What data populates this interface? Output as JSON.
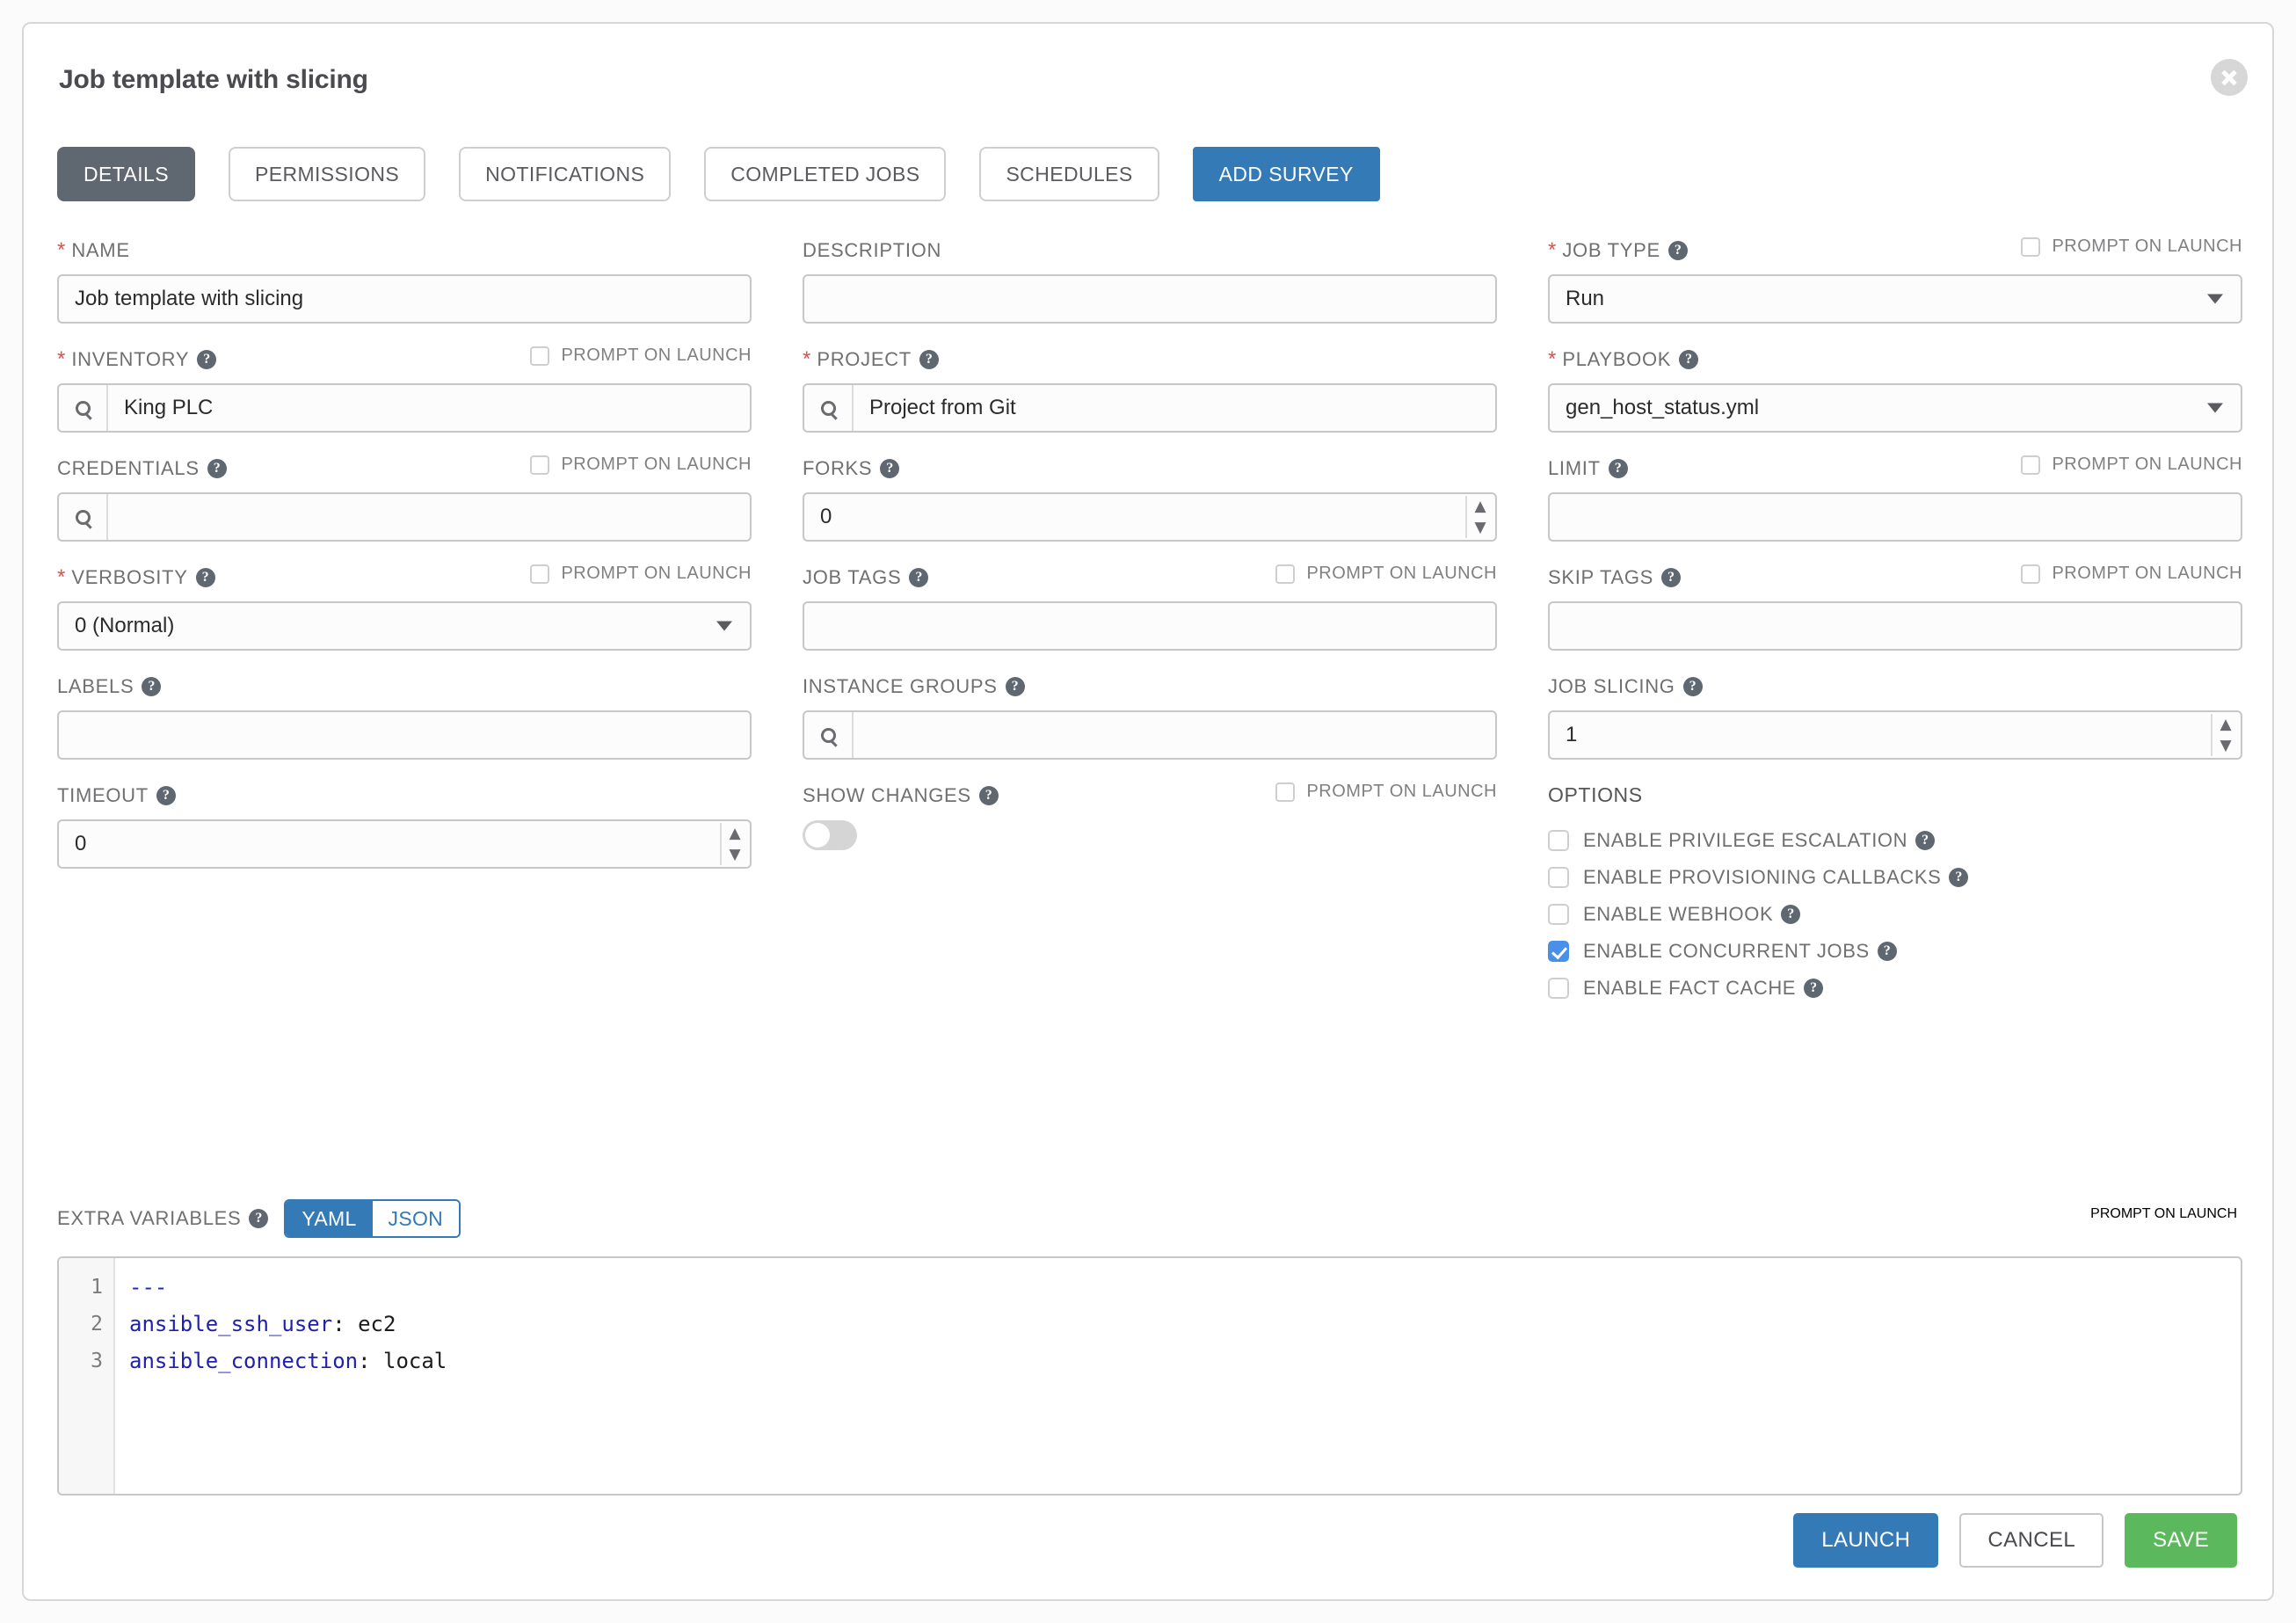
{
  "window": {
    "title": "Job template with slicing",
    "close_icon": "close-icon"
  },
  "tabs": [
    {
      "label": "DETAILS",
      "state": "active"
    },
    {
      "label": "PERMISSIONS",
      "state": "inactive"
    },
    {
      "label": "NOTIFICATIONS",
      "state": "inactive"
    },
    {
      "label": "COMPLETED JOBS",
      "state": "inactive"
    },
    {
      "label": "SCHEDULES",
      "state": "inactive"
    },
    {
      "label": "ADD SURVEY",
      "state": "primary"
    }
  ],
  "prompt_on_launch_label": "PROMPT ON LAUNCH",
  "fields": {
    "name": {
      "label": "NAME",
      "value": "Job template with slicing"
    },
    "description": {
      "label": "DESCRIPTION",
      "value": ""
    },
    "job_type": {
      "label": "JOB TYPE",
      "value": "Run"
    },
    "inventory": {
      "label": "INVENTORY",
      "value": "King PLC"
    },
    "project": {
      "label": "PROJECT",
      "value": "Project from Git"
    },
    "playbook": {
      "label": "PLAYBOOK",
      "value": "gen_host_status.yml"
    },
    "credentials": {
      "label": "CREDENTIALS",
      "value": ""
    },
    "forks": {
      "label": "FORKS",
      "value": "0"
    },
    "limit": {
      "label": "LIMIT",
      "value": ""
    },
    "verbosity": {
      "label": "VERBOSITY",
      "value": "0 (Normal)"
    },
    "job_tags": {
      "label": "JOB TAGS",
      "value": ""
    },
    "skip_tags": {
      "label": "SKIP TAGS",
      "value": ""
    },
    "labels": {
      "label": "LABELS",
      "value": ""
    },
    "instance_groups": {
      "label": "INSTANCE GROUPS",
      "value": ""
    },
    "job_slicing": {
      "label": "JOB SLICING",
      "value": "1"
    },
    "timeout": {
      "label": "TIMEOUT",
      "value": "0"
    },
    "show_changes": {
      "label": "SHOW CHANGES",
      "value": "off"
    }
  },
  "options": {
    "title": "OPTIONS",
    "items": [
      {
        "label": "ENABLE PRIVILEGE ESCALATION",
        "checked": false
      },
      {
        "label": "ENABLE PROVISIONING CALLBACKS",
        "checked": false
      },
      {
        "label": "ENABLE WEBHOOK",
        "checked": false
      },
      {
        "label": "ENABLE CONCURRENT JOBS",
        "checked": true
      },
      {
        "label": "ENABLE FACT CACHE",
        "checked": false
      }
    ]
  },
  "extra_variables": {
    "label": "EXTRA VARIABLES",
    "format_yaml": "YAML",
    "format_json": "JSON",
    "selected_format": "YAML",
    "lines": [
      {
        "no": "1",
        "doc": "---",
        "key": "",
        "value": ""
      },
      {
        "no": "2",
        "doc": "",
        "key": "ansible_ssh_user",
        "value": "ec2"
      },
      {
        "no": "3",
        "doc": "",
        "key": "ansible_connection",
        "value": "local"
      }
    ]
  },
  "footer": {
    "launch": "LAUNCH",
    "cancel": "CANCEL",
    "save": "SAVE"
  },
  "colors": {
    "accent_blue": "#337ab7",
    "save_green": "#5cb85c",
    "active_tab": "#5f6771",
    "required_red": "#d9534f",
    "checkbox_blue": "#4a90e8"
  }
}
